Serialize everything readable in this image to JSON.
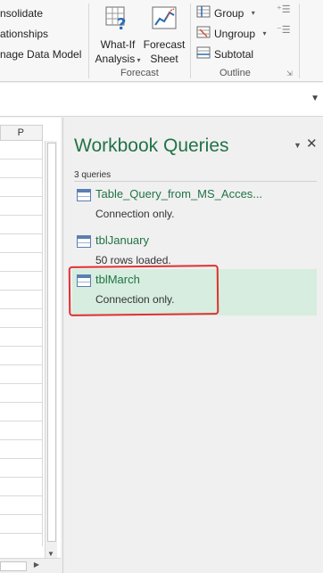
{
  "ribbon": {
    "data_tools": {
      "consolidate": "nsolidate",
      "relationships": "ationships",
      "manage_data_model": "nage Data Model"
    },
    "forecast": {
      "what_if_line1": "What-If",
      "what_if_line2": "Analysis",
      "forecast_sheet_line1": "Forecast",
      "forecast_sheet_line2": "Sheet",
      "group_label": "Forecast"
    },
    "outline": {
      "group": "Group",
      "ungroup": "Ungroup",
      "subtotal": "Subtotal",
      "group_label": "Outline"
    }
  },
  "sheet": {
    "column_header": "P"
  },
  "queries_pane": {
    "title": "Workbook Queries",
    "count": "3 queries",
    "items": [
      {
        "name": "Table_Query_from_MS_Acces...",
        "status": "Connection only."
      },
      {
        "name": "tblJanuary",
        "status": "50 rows loaded."
      },
      {
        "name": "tblMarch",
        "status": "Connection only."
      }
    ],
    "selected_index": 2
  },
  "colors": {
    "accent_green": "#217346",
    "selected_bg": "#d6eddf",
    "annotation_red": "#e03030"
  }
}
